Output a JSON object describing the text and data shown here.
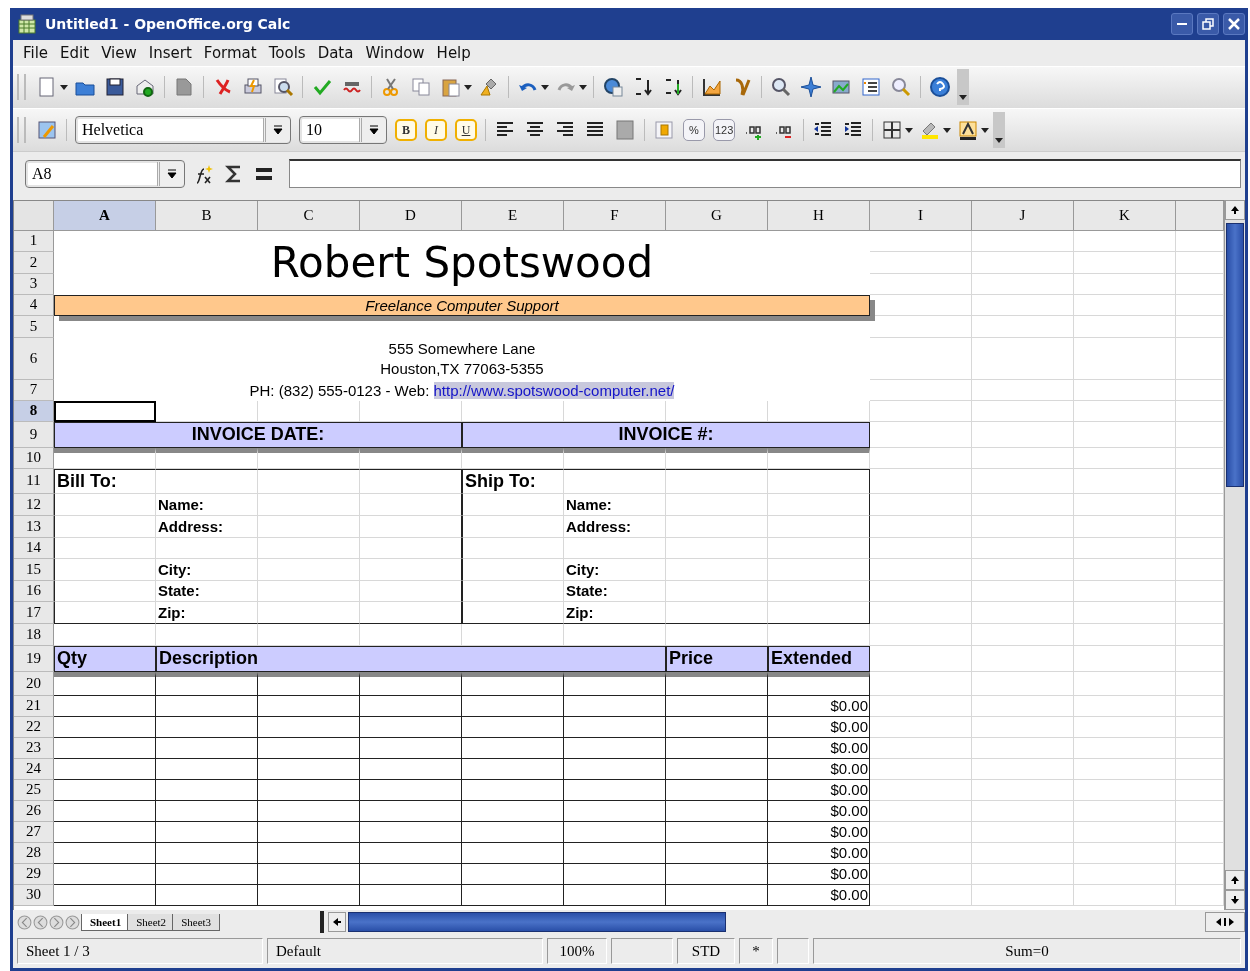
{
  "window": {
    "title": "Untitled1 - OpenOffice.org Calc"
  },
  "menu": [
    "File",
    "Edit",
    "View",
    "Insert",
    "Format",
    "Tools",
    "Data",
    "Window",
    "Help"
  ],
  "format_toolbar": {
    "font_name": "Helvetica",
    "font_size": "10",
    "style_buttons": [
      "B",
      "I",
      "U"
    ],
    "percent": "%",
    "number": "123"
  },
  "formula_bar": {
    "name_box": "A8"
  },
  "sheet": {
    "columns": [
      {
        "label": "A",
        "selected": true
      },
      {
        "label": "B",
        "selected": false
      },
      {
        "label": "C",
        "selected": false
      },
      {
        "label": "D",
        "selected": false
      },
      {
        "label": "E",
        "selected": false
      },
      {
        "label": "F",
        "selected": false
      },
      {
        "label": "G",
        "selected": false
      },
      {
        "label": "H",
        "selected": false
      },
      {
        "label": "I",
        "selected": false
      },
      {
        "label": "J",
        "selected": false
      },
      {
        "label": "K",
        "selected": false
      }
    ],
    "rows": [
      {
        "label": "1",
        "selected": false
      },
      {
        "label": "2",
        "selected": false
      },
      {
        "label": "3",
        "selected": false
      },
      {
        "label": "4",
        "selected": false
      },
      {
        "label": "5",
        "selected": false
      },
      {
        "label": "6",
        "selected": false
      },
      {
        "label": "7",
        "selected": false
      },
      {
        "label": "8",
        "selected": true
      },
      {
        "label": "9",
        "selected": false
      },
      {
        "label": "10",
        "selected": false
      },
      {
        "label": "11",
        "selected": false
      },
      {
        "label": "12",
        "selected": false
      },
      {
        "label": "13",
        "selected": false
      },
      {
        "label": "14",
        "selected": false
      },
      {
        "label": "15",
        "selected": false
      },
      {
        "label": "16",
        "selected": false
      },
      {
        "label": "17",
        "selected": false
      },
      {
        "label": "18",
        "selected": false
      },
      {
        "label": "19",
        "selected": false
      },
      {
        "label": "20",
        "selected": false
      },
      {
        "label": "21",
        "selected": false
      },
      {
        "label": "22",
        "selected": false
      },
      {
        "label": "23",
        "selected": false
      },
      {
        "label": "24",
        "selected": false
      },
      {
        "label": "25",
        "selected": false
      },
      {
        "label": "26",
        "selected": false
      },
      {
        "label": "27",
        "selected": false
      },
      {
        "label": "28",
        "selected": false
      },
      {
        "label": "29",
        "selected": false
      },
      {
        "label": "30",
        "selected": false
      }
    ],
    "letterhead": {
      "name": "Robert Spotswood",
      "tagline": "Freelance Computer Support",
      "address_lines": [
        "555 Somewhere Lane",
        "Houston,TX 77063-5355"
      ],
      "contact": "PH: (832) 555-0123 - Web: ",
      "website": "http://www.spotswood-computer.net/"
    },
    "invoice_bar": [
      "INVOICE DATE:",
      "INVOICE #:"
    ],
    "bill_to": {
      "title": "Bill To:",
      "fields": [
        "Name:",
        "Address:",
        "City:",
        "State:",
        "Zip:"
      ]
    },
    "ship_to": {
      "title": "Ship To:",
      "fields": [
        "Name:",
        "Address:",
        "City:",
        "State:",
        "Zip:"
      ]
    },
    "items_header": [
      "Qty",
      "Description",
      "Price",
      "Extended"
    ],
    "extended_values": [
      "$0.00",
      "$0.00",
      "$0.00",
      "$0.00",
      "$0.00",
      "$0.00",
      "$0.00",
      "$0.00",
      "$0.00",
      "$0.00"
    ]
  },
  "sheet_tabs": [
    {
      "label": "Sheet1",
      "selected": true
    },
    {
      "label": "Sheet2",
      "selected": false
    },
    {
      "label": "Sheet3",
      "selected": false
    }
  ],
  "status_bar": {
    "sheet": "Sheet 1 / 3",
    "page_style": "Default",
    "zoom": "100%",
    "selection_mode": "STD",
    "modified": "*",
    "sum": "Sum=0"
  }
}
